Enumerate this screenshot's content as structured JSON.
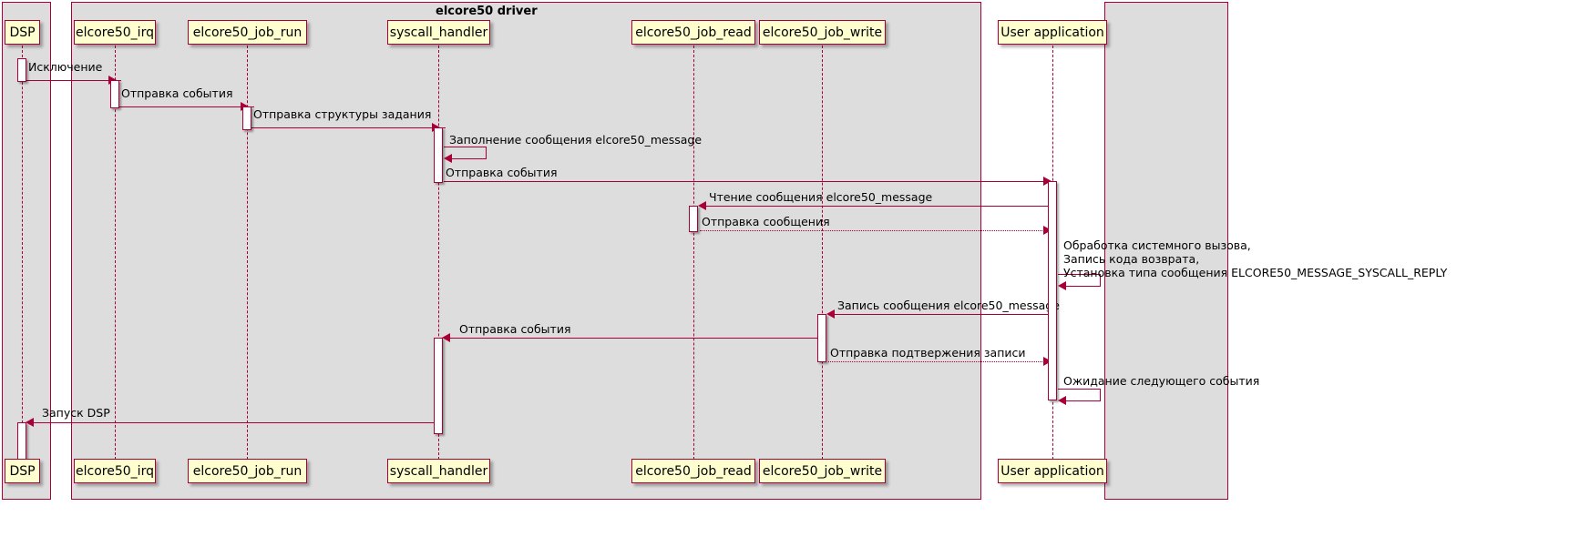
{
  "diagram": {
    "type": "uml-sequence-diagram",
    "frames": [
      {
        "id": "dsp_frame",
        "title": ""
      },
      {
        "id": "driver_frame",
        "title": "elcore50 driver"
      },
      {
        "id": "user_frame",
        "title": ""
      }
    ],
    "participants": [
      {
        "id": "dsp",
        "label": "DSP"
      },
      {
        "id": "irq",
        "label": "elcore50_irq"
      },
      {
        "id": "job_run",
        "label": "elcore50_job_run"
      },
      {
        "id": "syscall",
        "label": "syscall_handler"
      },
      {
        "id": "job_read",
        "label": "elcore50_job_read"
      },
      {
        "id": "job_write",
        "label": "elcore50_job_write"
      },
      {
        "id": "userapp",
        "label": "User application"
      }
    ],
    "messages": [
      {
        "id": "m1",
        "label": "Исключение",
        "from": "dsp",
        "to": "irq",
        "style": "solid"
      },
      {
        "id": "m2",
        "label": "Отправка события",
        "from": "irq",
        "to": "job_run",
        "style": "solid"
      },
      {
        "id": "m3",
        "label": "Отправка структуры задания",
        "from": "job_run",
        "to": "syscall",
        "style": "solid"
      },
      {
        "id": "m4",
        "label": "Заполнение сообщения elcore50_message",
        "from": "syscall",
        "to": "syscall",
        "style": "self"
      },
      {
        "id": "m5",
        "label": "Отправка события",
        "from": "syscall",
        "to": "userapp",
        "style": "solid"
      },
      {
        "id": "m6",
        "label": "Чтение сообщения elcore50_message",
        "from": "userapp",
        "to": "job_read",
        "style": "solid"
      },
      {
        "id": "m7",
        "label": "Отправка сообщения",
        "from": "job_read",
        "to": "userapp",
        "style": "dotted"
      },
      {
        "id": "m8",
        "label": "Обработка системного вызова,\nЗапись кода возврата,\nУстановка типа сообщения ELCORE50_MESSAGE_SYSCALL_REPLY",
        "from": "userapp",
        "to": "userapp",
        "style": "self"
      },
      {
        "id": "m9",
        "label": "Запись сообщения elcore50_message",
        "from": "userapp",
        "to": "job_write",
        "style": "solid"
      },
      {
        "id": "m10",
        "label": "Отправка события",
        "from": "job_write",
        "to": "syscall",
        "style": "solid"
      },
      {
        "id": "m11",
        "label": "Отправка подтвержения записи",
        "from": "job_write",
        "to": "userapp",
        "style": "dotted"
      },
      {
        "id": "m12",
        "label": "Ожидание следующего события",
        "from": "userapp",
        "to": "userapp",
        "style": "self"
      },
      {
        "id": "m13",
        "label": "Запуск DSP",
        "from": "syscall",
        "to": "dsp",
        "style": "solid"
      }
    ],
    "colors": {
      "line": "#A80036",
      "participant_fill": "#FEFECE",
      "frame_fill": "#DDDDDD",
      "activation_fill": "#FFFFFF",
      "page_background": "#FFFFFF",
      "text": "#000000"
    }
  }
}
